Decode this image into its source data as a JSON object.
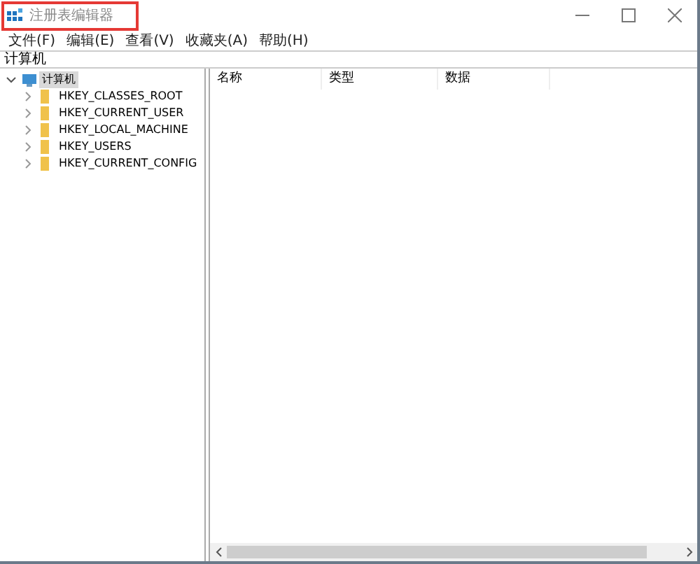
{
  "window": {
    "title": "注册表编辑器",
    "title_highlighted": true
  },
  "menu": [
    "文件(F)",
    "编辑(E)",
    "查看(V)",
    "收藏夹(A)",
    "帮助(H)"
  ],
  "address": "计算机",
  "tree": {
    "label": "计算机",
    "expanded": true,
    "selected": true,
    "children": [
      {
        "label": "HKEY_CLASSES_ROOT",
        "expanded": false,
        "selected": false
      },
      {
        "label": "HKEY_CURRENT_USER",
        "expanded": false,
        "selected": false
      },
      {
        "label": "HKEY_LOCAL_MACHINE",
        "expanded": false,
        "selected": false
      },
      {
        "label": "HKEY_USERS",
        "expanded": false,
        "selected": false
      },
      {
        "label": "HKEY_CURRENT_CONFIG",
        "expanded": false,
        "selected": false
      }
    ]
  },
  "table": {
    "columns": [
      "名称",
      "类型",
      "数据"
    ]
  }
}
